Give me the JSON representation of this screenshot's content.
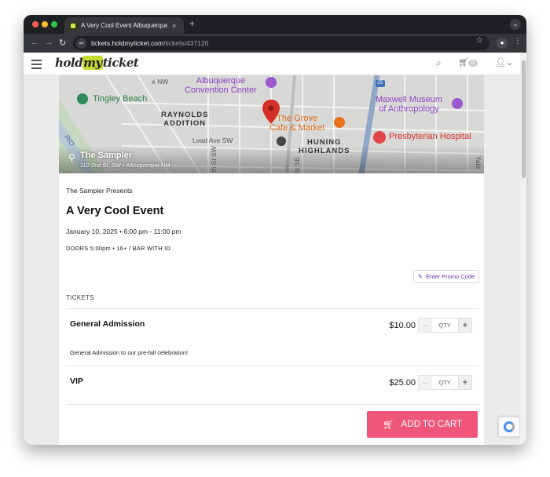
{
  "browser": {
    "tab_title": "A Very Cool Event Albuquerque",
    "tab_close": "×",
    "new_tab": "+",
    "url_host": "tickets.holdmyticket.com",
    "url_path": "/tickets/437126"
  },
  "site": {
    "logo_hold": "hold",
    "logo_my": "my",
    "logo_ticket": "ticket",
    "cart_count": "0"
  },
  "map": {
    "labels": {
      "convention": "Albuquerque\nConvention Center",
      "tingley": "Tingley Beach",
      "raynolds": "RAYNOLDS\nADDITION",
      "grove": "The Grove\nCafe & Market",
      "huning": "HUNING\nHIGHLANDS",
      "maxwell": "Maxwell Museum\nof Anthropology",
      "presbyterian": "Presbyterian Hospital",
      "lead_ave": "Lead Ave SW",
      "st_sw": "th St SW",
      "rio": "RIO",
      "highway": "25",
      "yale": "Yale",
      "nw": "e NW",
      "se": "St SE"
    },
    "venue_name": "The Sampler",
    "venue_address": "110 2nd St. SW • Albuquerque NM"
  },
  "event": {
    "presenter": "The Sampler Presents",
    "title": "A Very Cool Event",
    "date": "January 10, 2025 • 6:00 pm - 11:00 pm",
    "doors": "DOORS 5:00pm  •  16+ / BAR WITH ID"
  },
  "promo_label": "Enter Promo Code",
  "tickets_header": "TICKETS",
  "tickets": [
    {
      "name": "General Admission",
      "price": "$10.00",
      "qty_placeholder": "QTY",
      "description": "General Admission to our pre-fall celebration!"
    },
    {
      "name": "VIP",
      "price": "$25.00",
      "qty_placeholder": "QTY"
    }
  ],
  "qty_minus": "–",
  "qty_plus": "+",
  "add_to_cart": "ADD TO CART",
  "colors": {
    "accent_pink": "#f0567a",
    "promo_purple": "#6b2fb5",
    "logo_green": "#c9db2e"
  }
}
